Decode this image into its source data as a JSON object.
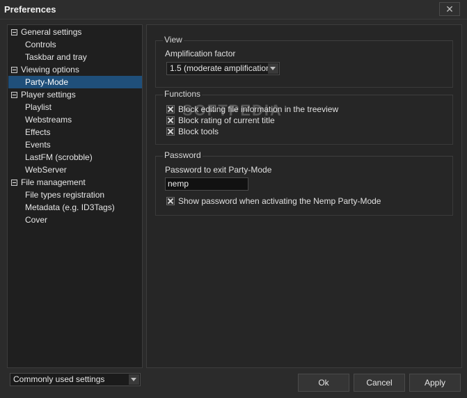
{
  "window": {
    "title": "Preferences",
    "close_glyph": "✕"
  },
  "tree": {
    "items": [
      {
        "label": "General settings",
        "level": 0
      },
      {
        "label": "Controls",
        "level": 1
      },
      {
        "label": "Taskbar and tray",
        "level": 1
      },
      {
        "label": "Viewing options",
        "level": 0
      },
      {
        "label": "Party-Mode",
        "level": 1,
        "selected": true
      },
      {
        "label": "Player settings",
        "level": 0
      },
      {
        "label": "Playlist",
        "level": 1
      },
      {
        "label": "Webstreams",
        "level": 1
      },
      {
        "label": "Effects",
        "level": 1
      },
      {
        "label": "Events",
        "level": 1
      },
      {
        "label": "LastFM (scrobble)",
        "level": 1
      },
      {
        "label": "WebServer",
        "level": 1
      },
      {
        "label": "File management",
        "level": 0
      },
      {
        "label": "File types registration",
        "level": 1
      },
      {
        "label": "Metadata (e.g. ID3Tags)",
        "level": 1
      },
      {
        "label": "Cover",
        "level": 1
      }
    ]
  },
  "bottom_combo": {
    "value": "Commonly used settings"
  },
  "view": {
    "title": "View",
    "amplification_label": "Amplification factor",
    "amplification_value": "1.5 (moderate amplification)"
  },
  "functions": {
    "title": "Functions",
    "items": [
      {
        "label": "Block editing file information in the treeview",
        "checked": true
      },
      {
        "label": "Block rating of current title",
        "checked": true
      },
      {
        "label": "Block tools",
        "checked": true
      }
    ]
  },
  "password": {
    "title": "Password",
    "label": "Password to exit Party-Mode",
    "value": "nemp",
    "show_label": "Show password when activating the Nemp Party-Mode",
    "show_checked": true
  },
  "watermark": "SOFTPEDIA",
  "buttons": {
    "ok": "Ok",
    "cancel": "Cancel",
    "apply": "Apply"
  }
}
